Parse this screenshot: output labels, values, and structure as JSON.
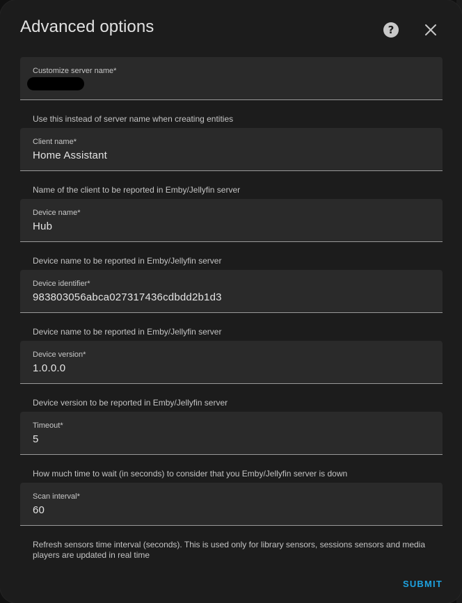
{
  "dialog": {
    "title": "Advanced options",
    "help_icon": "help-circle-icon",
    "close_icon": "close-icon",
    "submit_label": "SUBMIT",
    "accent_color": "#1ea2e0"
  },
  "fields": [
    {
      "label": "Customize server name*",
      "value": "",
      "redacted": true,
      "helper": "Use this instead of server name when creating entities"
    },
    {
      "label": "Client name*",
      "value": "Home Assistant",
      "helper": "Name of the client to be reported in Emby/Jellyfin server"
    },
    {
      "label": "Device name*",
      "value": "Hub",
      "helper": "Device name to be reported in Emby/Jellyfin server"
    },
    {
      "label": "Device identifier*",
      "value": "983803056abca027317436cdbdd2b1d3",
      "helper": "Device name to be reported in Emby/Jellyfin server"
    },
    {
      "label": "Device version*",
      "value": "1.0.0.0",
      "helper": "Device version to be reported in Emby/Jellyfin server"
    },
    {
      "label": "Timeout*",
      "value": "5",
      "helper": "How much time to wait (in seconds) to consider that you Emby/Jellyfin server is down"
    },
    {
      "label": "Scan interval*",
      "value": "60",
      "helper": "Refresh sensors time interval (seconds). This is used only for library sensors, sessions sensors and media players are updated in real time"
    }
  ]
}
